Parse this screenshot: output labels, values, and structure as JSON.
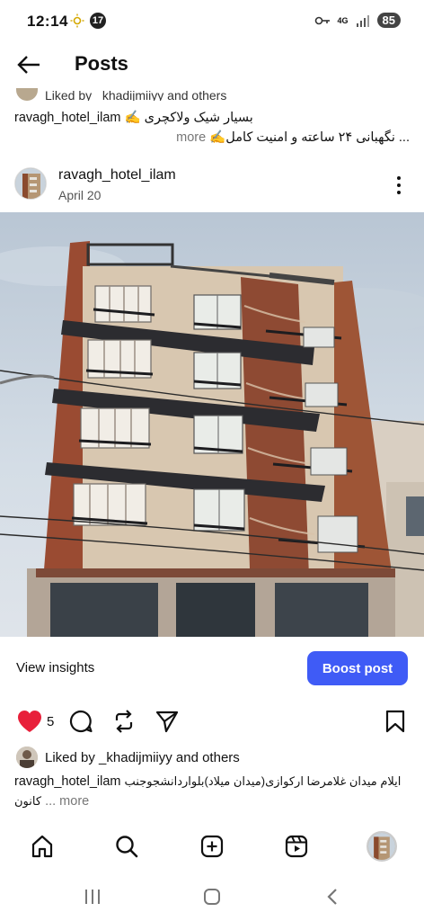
{
  "status_bar": {
    "time": "12:14",
    "notification_count": "17",
    "network": "4G",
    "battery": "85"
  },
  "header": {
    "title": "Posts"
  },
  "prev_post": {
    "liked_by": "Liked by _khadijmiiyy and others",
    "username": "ravagh_hotel_ilam",
    "caption_line1": "✍️ بسیار شیک ولاکچری",
    "caption_line2": "✍️نگهبانی ۲۴ ساعته و امنیت کامل ...",
    "more": "more"
  },
  "post": {
    "username": "ravagh_hotel_ilam",
    "date": "April 20",
    "view_insights": "View insights",
    "boost_post": "Boost post",
    "like_count": "5",
    "liked_by": "Liked by _khadijmiiyy and others",
    "caption_username": "ravagh_hotel_ilam",
    "caption_text": "ایلام میدان غلامرضا ارکوازی(میدان میلاد)بلواردانشجوجنب کانون",
    "more": "... more"
  },
  "colors": {
    "accent": "#3f5bf6",
    "like": "#e8203a"
  },
  "icons": {
    "back": "arrow-left-icon",
    "menu": "kebab-menu-icon",
    "like": "heart-icon",
    "comment": "comment-icon",
    "repost": "repost-icon",
    "share": "send-icon",
    "save": "bookmark-icon",
    "home": "home-icon",
    "search": "search-icon",
    "create": "plus-square-icon",
    "reels": "reels-icon"
  }
}
